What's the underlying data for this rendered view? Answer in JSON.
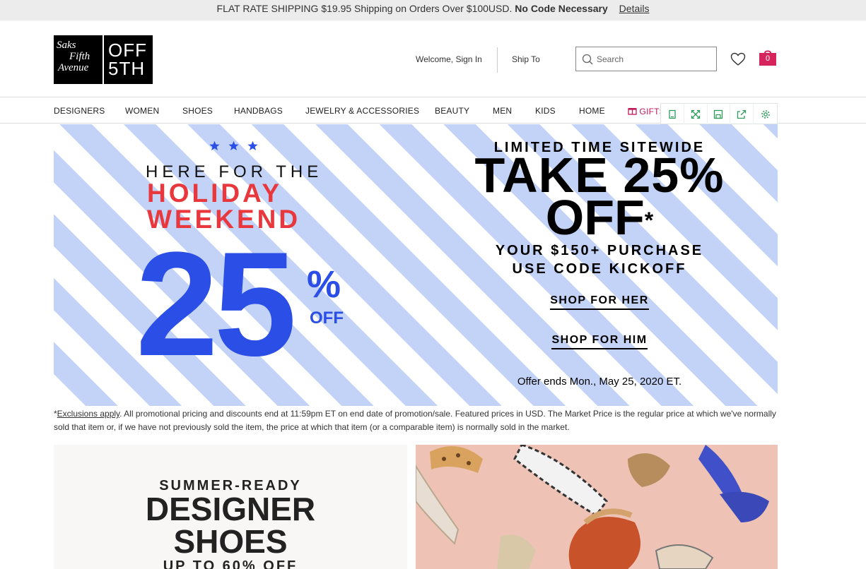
{
  "promo_bar": {
    "text": "FLAT RATE SHIPPING $19.95 Shipping on Orders Over $100USD.",
    "bold": "No Code Necessary",
    "details_link": "Details"
  },
  "logo": {
    "saks_lines": [
      "Saks",
      "Fifth",
      "Avenue"
    ],
    "off5th_lines": [
      "OFF",
      "5TH"
    ]
  },
  "header": {
    "welcome": "Welcome, Sign In",
    "ship_to": "Ship To",
    "search_placeholder": "Search",
    "bag_count": "0"
  },
  "nav": {
    "items": [
      "DESIGNERS",
      "WOMEN",
      "SHOES",
      "HANDBAGS",
      "JEWELRY & ACCESSORIES",
      "BEAUTY",
      "MEN",
      "KIDS",
      "HOME"
    ],
    "gifts": "GIFTS"
  },
  "hero": {
    "here_for_the": "HERE FOR THE",
    "holiday": "HOLIDAY",
    "weekend": "WEEKEND",
    "big_number": "25",
    "percent": "%",
    "percent_off": "OFF",
    "limited": "LIMITED TIME SITEWIDE",
    "take": "TAKE 25%",
    "off": "OFF",
    "asterisk": "*",
    "purchase_line1": "YOUR $150+ PURCHASE",
    "purchase_line2": "USE CODE KICKOFF",
    "shop_her": "SHOP FOR HER",
    "shop_him": "SHOP FOR HIM",
    "offer_ends": "Offer ends Mon., May 25, 2020 ET."
  },
  "disclaimer": {
    "prefix": "*",
    "exclusions_link": "Exclusions apply",
    "text": ". All promotional pricing and discounts end at 11:59pm ET on end date of promotion/sale. Featured prices in USD. The Market Price is the regular price at which we've normally sold that item or, if we have not previously sold the item, the price at which that item (or a comparable item) is normally sold in the market."
  },
  "lower": {
    "summer_ready": "SUMMER-READY",
    "designer": "DESIGNER",
    "shoes": "SHOES",
    "up_to": "UP TO 60% OFF"
  },
  "colors": {
    "stripe_blue": "#c2d3f7",
    "holiday_red": "#e8383d",
    "promo_blue": "#2a4ee6",
    "bag_pink": "#d6245c"
  }
}
